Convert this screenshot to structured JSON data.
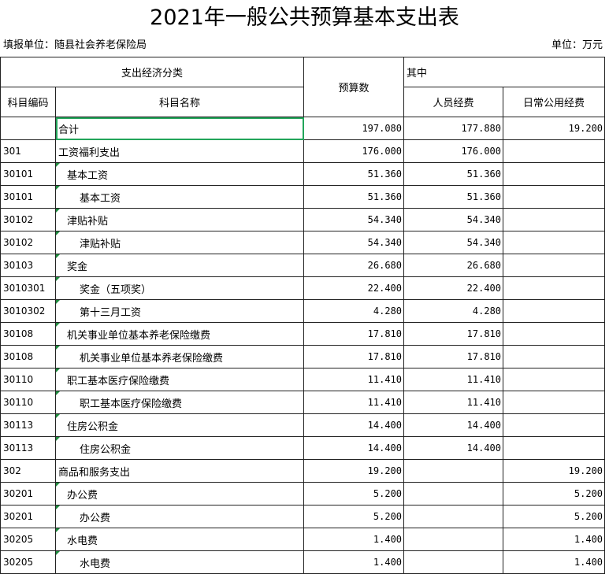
{
  "title": "2021年一般公共预算基本支出表",
  "meta": {
    "unit_left": "填报单位：随县社会养老保险局",
    "unit_right": "单位：万元"
  },
  "header": {
    "econ_class": "支出经济分类",
    "budget": "预算数",
    "among": "其中",
    "code": "科目编码",
    "name": "科目名称",
    "personnel": "人员经费",
    "daily": "日常公用经费"
  },
  "rows": [
    {
      "code": "",
      "name": "合计",
      "budget": "197.080",
      "personnel": "177.880",
      "daily": "19.200"
    },
    {
      "code": "301",
      "name": "工资福利支出",
      "budget": "176.000",
      "personnel": "176.000",
      "daily": ""
    },
    {
      "code": "30101",
      "name": "基本工资",
      "budget": "51.360",
      "personnel": "51.360",
      "daily": ""
    },
    {
      "code": "30101",
      "name": "基本工资",
      "budget": "51.360",
      "personnel": "51.360",
      "daily": ""
    },
    {
      "code": "30102",
      "name": "津贴补贴",
      "budget": "54.340",
      "personnel": "54.340",
      "daily": ""
    },
    {
      "code": "30102",
      "name": "津贴补贴",
      "budget": "54.340",
      "personnel": "54.340",
      "daily": ""
    },
    {
      "code": "30103",
      "name": "奖金",
      "budget": "26.680",
      "personnel": "26.680",
      "daily": ""
    },
    {
      "code": "3010301",
      "name": "奖金（五项奖）",
      "budget": "22.400",
      "personnel": "22.400",
      "daily": ""
    },
    {
      "code": "3010302",
      "name": "第十三月工资",
      "budget": "4.280",
      "personnel": "4.280",
      "daily": ""
    },
    {
      "code": "30108",
      "name": "机关事业单位基本养老保险缴费",
      "budget": "17.810",
      "personnel": "17.810",
      "daily": ""
    },
    {
      "code": "30108",
      "name": "机关事业单位基本养老保险缴费",
      "budget": "17.810",
      "personnel": "17.810",
      "daily": ""
    },
    {
      "code": "30110",
      "name": "职工基本医疗保险缴费",
      "budget": "11.410",
      "personnel": "11.410",
      "daily": ""
    },
    {
      "code": "30110",
      "name": "职工基本医疗保险缴费",
      "budget": "11.410",
      "personnel": "11.410",
      "daily": ""
    },
    {
      "code": "30113",
      "name": "住房公积金",
      "budget": "14.400",
      "personnel": "14.400",
      "daily": ""
    },
    {
      "code": "30113",
      "name": "住房公积金",
      "budget": "14.400",
      "personnel": "14.400",
      "daily": ""
    },
    {
      "code": "302",
      "name": "商品和服务支出",
      "budget": "19.200",
      "personnel": "",
      "daily": "19.200"
    },
    {
      "code": "30201",
      "name": "办公费",
      "budget": "5.200",
      "personnel": "",
      "daily": "5.200"
    },
    {
      "code": "30201",
      "name": "办公费",
      "budget": "5.200",
      "personnel": "",
      "daily": "5.200"
    },
    {
      "code": "30205",
      "name": "水电费",
      "budget": "1.400",
      "personnel": "",
      "daily": "1.400"
    },
    {
      "code": "30205",
      "name": "水电费",
      "budget": "1.400",
      "personnel": "",
      "daily": "1.400"
    }
  ]
}
